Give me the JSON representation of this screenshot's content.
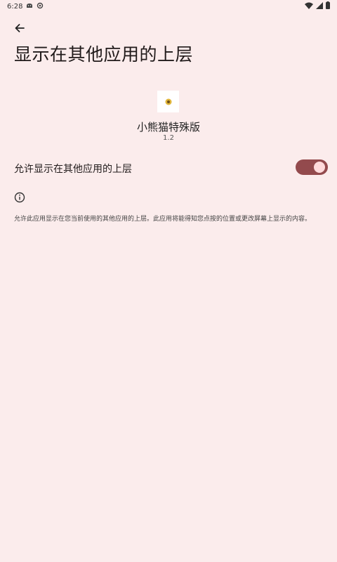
{
  "status_bar": {
    "time": "6:28",
    "icons": [
      "android-notification-icon",
      "sync-icon",
      "wifi-icon",
      "signal-icon",
      "battery-icon"
    ]
  },
  "header": {
    "title": "显示在其他应用的上层",
    "back_icon": "arrow-back-icon"
  },
  "app": {
    "name": "小熊猫特殊版",
    "version": "1.2",
    "icon": "app-logo-icon"
  },
  "permission": {
    "label": "允许显示在其他应用的上层",
    "enabled": true
  },
  "info": {
    "icon": "info-icon",
    "description": "允许此应用显示在您当前使用的其他应用的上层。此应用将能得知您点按的位置或更改屏幕上显示的内容。"
  },
  "colors": {
    "background": "#fbecec",
    "toggle_track": "#934a4d",
    "toggle_thumb": "#ffdadb"
  }
}
